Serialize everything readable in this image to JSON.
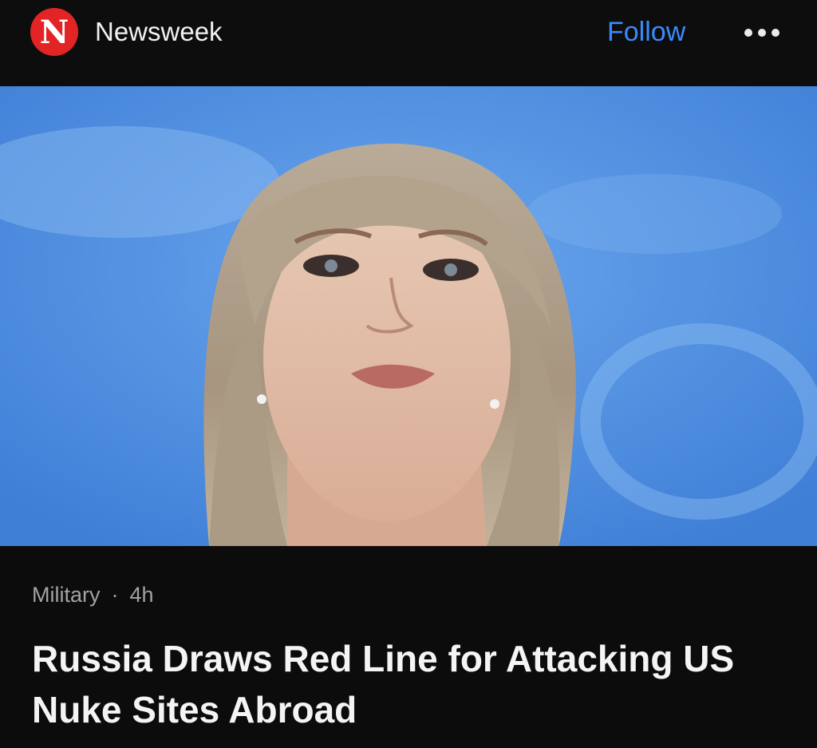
{
  "header": {
    "logo_letter": "N",
    "publisher_name": "Newsweek",
    "follow_label": "Follow",
    "more_icon": "more-horizontal-icon",
    "brand_color": "#e32424",
    "accent_color": "#3a8bff"
  },
  "article": {
    "category": "Military",
    "separator": "·",
    "age": "4h",
    "headline": "Russia Draws Red Line for Attacking US Nuke Sites Abroad"
  }
}
